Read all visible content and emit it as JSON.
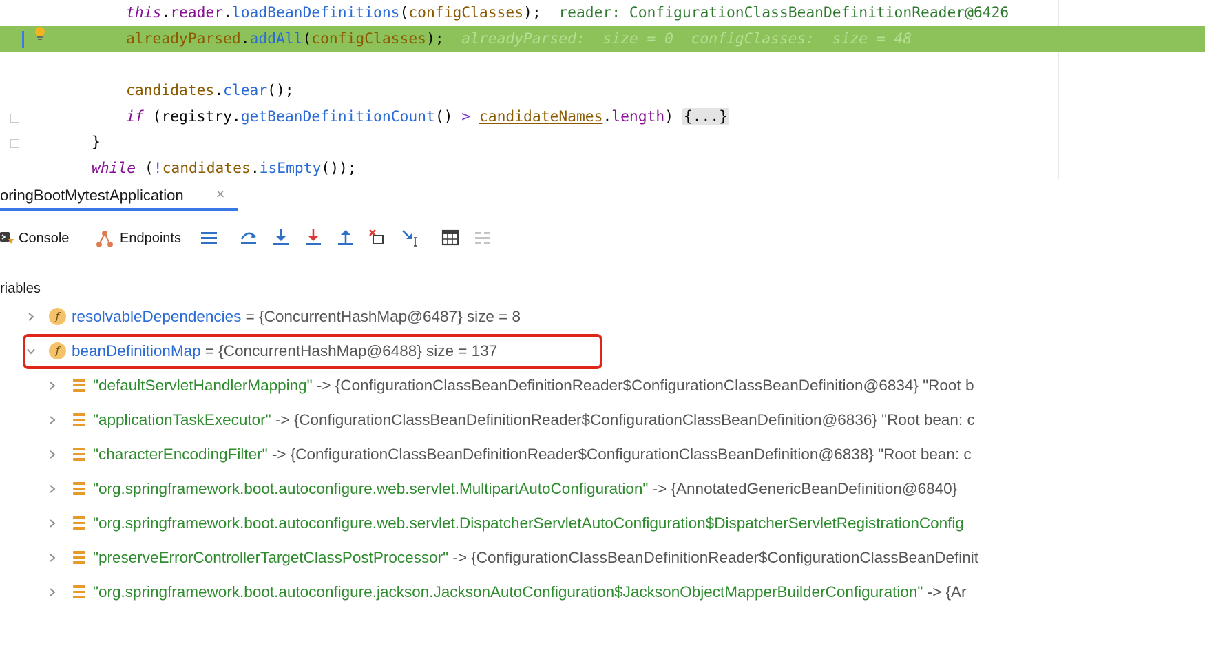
{
  "editor": {
    "lines": [
      {
        "parts": [
          {
            "t": "this",
            "c": "kwi"
          },
          {
            "t": ".",
            "c": ""
          },
          {
            "t": "reader",
            "c": "fld"
          },
          {
            "t": ".",
            "c": ""
          },
          {
            "t": "loadBeanDefinitions",
            "c": "mth"
          },
          {
            "t": "(",
            "c": ""
          },
          {
            "t": "configClasses",
            "c": "lcl"
          },
          {
            "t": ");",
            "c": ""
          },
          {
            "t": "  reader: ConfigurationClassBeanDefinitionReader@6426",
            "c": "inl"
          }
        ]
      },
      {
        "parts": [
          {
            "t": "alreadyParsed",
            "c": "lcl"
          },
          {
            "t": ".",
            "c": ""
          },
          {
            "t": "addAll",
            "c": "mth"
          },
          {
            "t": "(",
            "c": ""
          },
          {
            "t": "configClasses",
            "c": "lcl"
          },
          {
            "t": ");",
            "c": ""
          },
          {
            "t": "  alreadyParsed:  size = 0  configClasses:  size = 48",
            "c": "inl-hl"
          }
        ]
      },
      {
        "parts": [
          {
            "t": "candidates",
            "c": "lcl"
          },
          {
            "t": ".",
            "c": ""
          },
          {
            "t": "clear",
            "c": "mth"
          },
          {
            "t": "();",
            "c": ""
          }
        ]
      },
      {
        "parts": [
          {
            "t": "if",
            "c": "kwi"
          },
          {
            "t": " (",
            "c": ""
          },
          {
            "t": "registry",
            "c": ""
          },
          {
            "t": ".",
            "c": ""
          },
          {
            "t": "getBeanDefinitionCount",
            "c": "mth"
          },
          {
            "t": "() ",
            "c": ""
          },
          {
            "t": ">",
            "c": "op"
          },
          {
            "t": " ",
            "c": ""
          },
          {
            "t": "candidateNames",
            "c": "lcl und"
          },
          {
            "t": ".",
            "c": ""
          },
          {
            "t": "length",
            "c": "fld"
          },
          {
            "t": ") ",
            "c": ""
          },
          {
            "t": "{...}",
            "c": "fold"
          }
        ]
      },
      {
        "parts": [
          {
            "t": "}",
            "c": ""
          }
        ]
      },
      {
        "parts": [
          {
            "t": "while",
            "c": "kwi"
          },
          {
            "t": " (",
            "c": ""
          },
          {
            "t": "!",
            "c": "op"
          },
          {
            "t": "candidates",
            "c": "lcl"
          },
          {
            "t": ".",
            "c": ""
          },
          {
            "t": "isEmpty",
            "c": "mth"
          },
          {
            "t": "());",
            "c": ""
          }
        ]
      }
    ]
  },
  "debug": {
    "session_tab": "oringBootMytestApplication",
    "close_glyph": "×",
    "toolbar": {
      "console_label": "Console",
      "endpoints_label": "Endpoints"
    },
    "variables_label": "riables",
    "tree": {
      "cut_row": {
        "name": "resolvableDependencies",
        "value": " = {ConcurrentHashMap@6487}  size = 8"
      },
      "selected_row": {
        "name": "beanDefinitionMap",
        "value": " = {ConcurrentHashMap@6488}  size = 137"
      },
      "entries": [
        {
          "key": "\"defaultServletHandlerMapping\"",
          "value": " -> {ConfigurationClassBeanDefinitionReader$ConfigurationClassBeanDefinition@6834} \"Root b"
        },
        {
          "key": "\"applicationTaskExecutor\"",
          "value": " -> {ConfigurationClassBeanDefinitionReader$ConfigurationClassBeanDefinition@6836} \"Root bean: c"
        },
        {
          "key": "\"characterEncodingFilter\"",
          "value": " -> {ConfigurationClassBeanDefinitionReader$ConfigurationClassBeanDefinition@6838} \"Root bean: c"
        },
        {
          "key": "\"org.springframework.boot.autoconfigure.web.servlet.MultipartAutoConfiguration\"",
          "value": " -> {AnnotatedGenericBeanDefinition@6840}"
        },
        {
          "key": "\"org.springframework.boot.autoconfigure.web.servlet.DispatcherServletAutoConfiguration$DispatcherServletRegistrationConfig",
          "value": ""
        },
        {
          "key": "\"preserveErrorControllerTargetClassPostProcessor\"",
          "value": " -> {ConfigurationClassBeanDefinitionReader$ConfigurationClassBeanDefinit"
        },
        {
          "key": "\"org.springframework.boot.autoconfigure.jackson.JacksonAutoConfiguration$JacksonObjectMapperBuilderConfiguration\"",
          "value": " -> {Ar"
        }
      ]
    }
  },
  "colors": {
    "highlight_line": "#8dc25b",
    "selection_border": "#e0251a",
    "accent": "#3b78e7",
    "string_green": "#2e8b2e",
    "name_blue": "#2a6bd6"
  }
}
